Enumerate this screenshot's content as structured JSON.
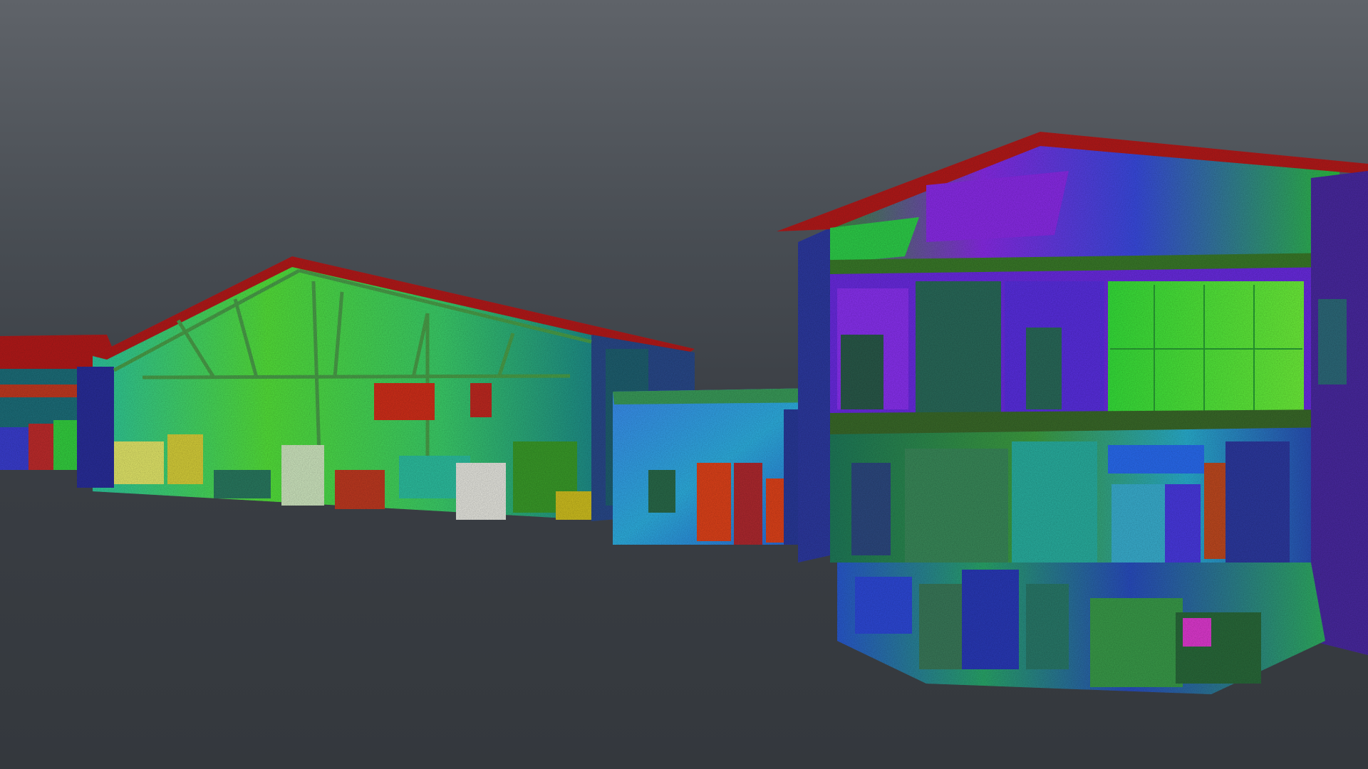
{
  "viewer": {
    "render_mode": "point-cloud",
    "color_scale": "intensity-rainbow",
    "colors": {
      "sky_top": "#5f6369",
      "sky_bottom": "#3a3e44",
      "ground": "#34383d",
      "roof_red": "#b51a1a",
      "interior_green": "#3fe238",
      "interior_blue": "#2a6fe0",
      "interior_purple": "#7d2ee0",
      "door_orange": "#e0431c"
    }
  },
  "scene": {
    "objects": [
      {
        "id": "far-left-building",
        "type": "building"
      },
      {
        "id": "warehouse-shed",
        "type": "building"
      },
      {
        "id": "small-blue-annex",
        "type": "building"
      },
      {
        "id": "main-sectioned-building",
        "type": "building"
      }
    ]
  }
}
